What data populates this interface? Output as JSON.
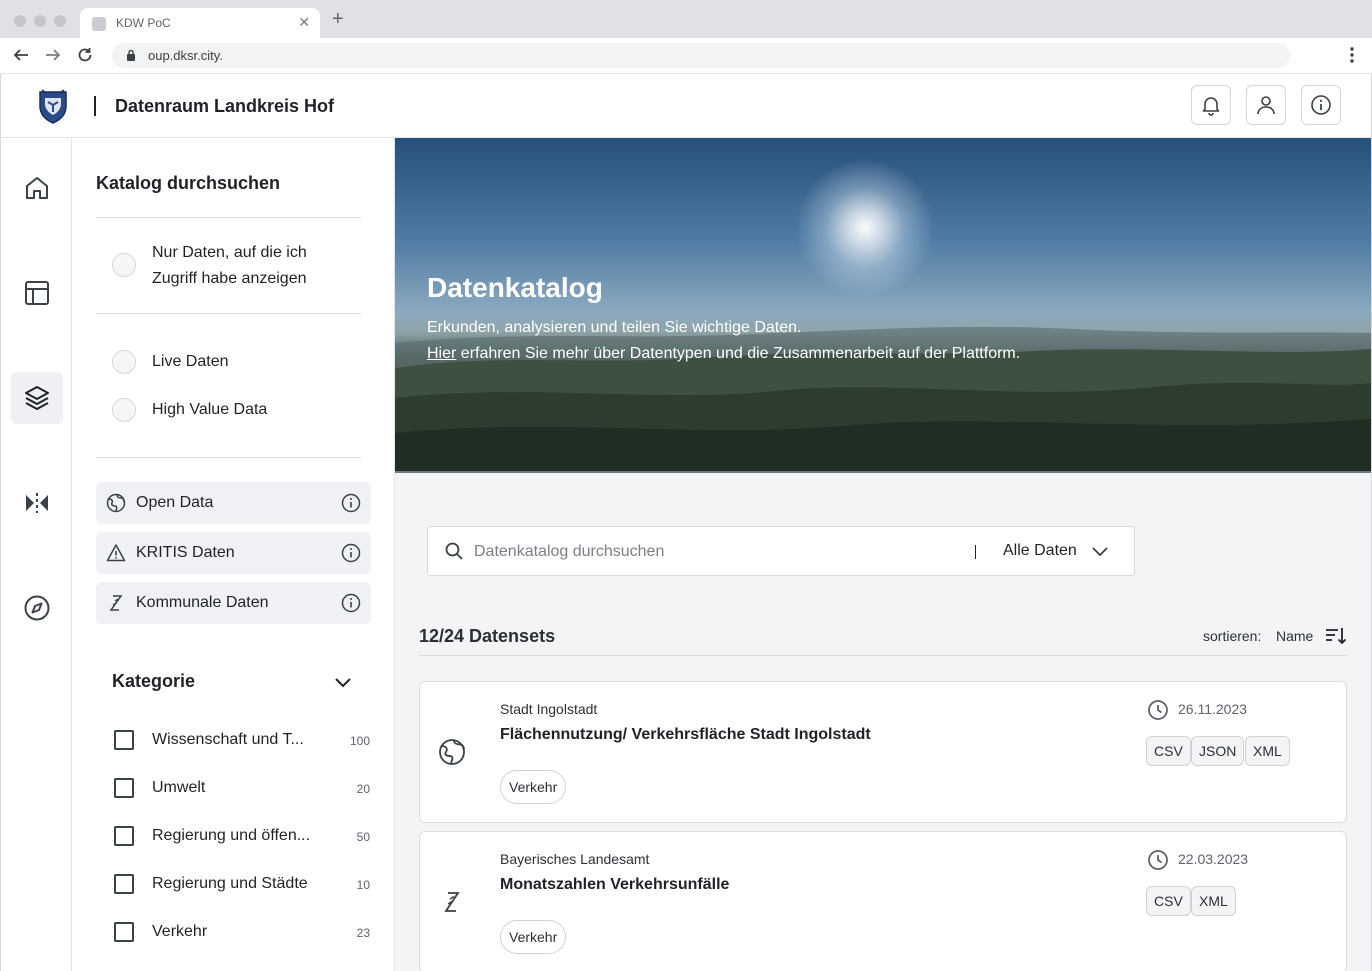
{
  "browser": {
    "tab_title": "KDW PoC",
    "url": "oup.dksr.city."
  },
  "header": {
    "title": "Datenraum Landkreis Hof"
  },
  "filters": {
    "title": "Katalog durchsuchen",
    "access_only": "Nur Daten, auf die ich Zugriff habe anzeigen",
    "live": "Live Daten",
    "high_value": "High Value Data",
    "types": [
      {
        "label": "Open Data"
      },
      {
        "label": "KRITIS Daten"
      },
      {
        "label": "Kommunale Daten"
      }
    ],
    "category_title": "Kategorie",
    "categories": [
      {
        "label": "Wissenschaft und T...",
        "count": "100"
      },
      {
        "label": "Umwelt",
        "count": "20"
      },
      {
        "label": "Regierung und öffen...",
        "count": "50"
      },
      {
        "label": "Regierung und Städte",
        "count": "10"
      },
      {
        "label": "Verkehr",
        "count": "23"
      }
    ]
  },
  "hero": {
    "title": "Datenkatalog",
    "subtitle": "Erkunden, analysieren und teilen Sie wichtige Daten.",
    "link": "Hier",
    "link_rest": " erfahren Sie mehr über Datentypen und die Zusammenarbeit auf der Plattform."
  },
  "search": {
    "placeholder": "Datenkatalog durchsuchen",
    "scope": "Alle Daten"
  },
  "results": {
    "count": "12/24 Datensets",
    "sort_label": "sortieren:",
    "sort_value": "Name",
    "items": [
      {
        "publisher": "Stadt Ingolstadt",
        "title": "Flächennutzung/ Verkehrsfläche Stadt Ingolstadt",
        "tag": "Verkehr",
        "date": "26.11.2023",
        "formats": [
          "CSV",
          "JSON",
          "XML"
        ],
        "type_icon": "globe-icon"
      },
      {
        "publisher": "Bayerisches Landesamt",
        "title": "Monatszahlen Verkehrsunfälle",
        "tag": "Verkehr",
        "date": "22.03.2023",
        "formats": [
          "CSV",
          "XML"
        ],
        "type_icon": "kommunal-icon"
      }
    ]
  },
  "colors": {
    "accent": "#1f2328",
    "surface": "#ffffff",
    "background": "#f3f4f6"
  }
}
